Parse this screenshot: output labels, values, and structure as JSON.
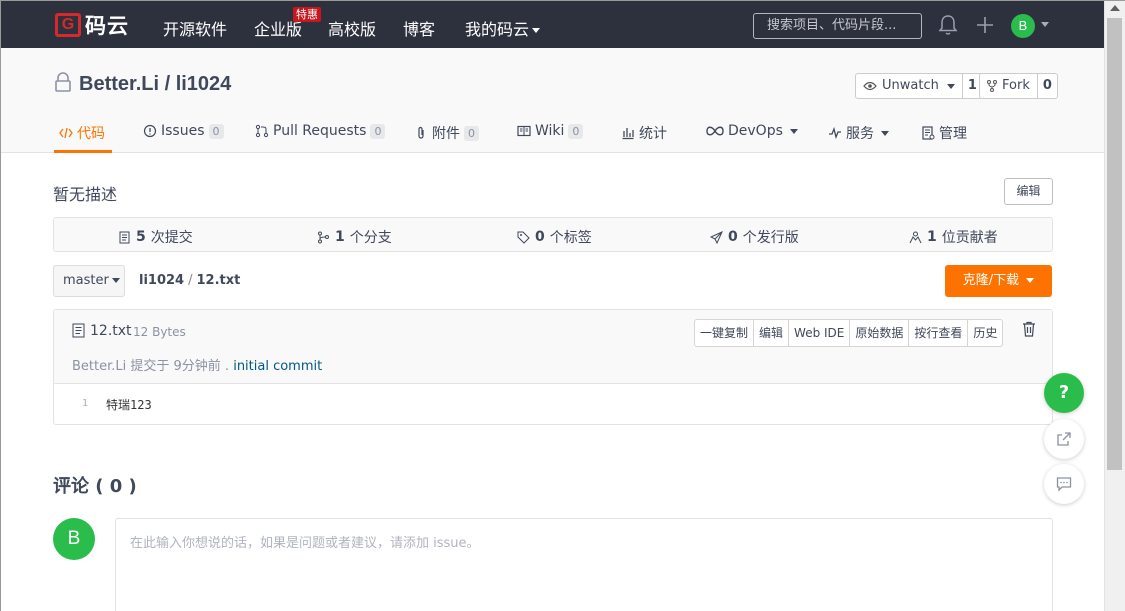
{
  "topnav": {
    "logo_mark": "G",
    "logo_text": "码云",
    "items": [
      "开源软件",
      "企业版",
      "高校版",
      "博客",
      "我的码云"
    ],
    "enterprise_badge": "特惠",
    "search_placeholder": "搜索项目、代码片段...",
    "avatar_letter": "B",
    "colors": {
      "bg": "#2d313e",
      "brand": "#d7292c",
      "avatar": "#2abd4c"
    }
  },
  "repo": {
    "title": "Better.Li / li1024",
    "watch_label": "Unwatch",
    "watch_count": "1",
    "fork_label": "Fork",
    "fork_count": "0"
  },
  "tabs": {
    "code": "代码",
    "issues": "Issues",
    "issues_count": "0",
    "pulls": "Pull Requests",
    "pulls_count": "0",
    "attachments": "附件",
    "attachments_count": "0",
    "wiki": "Wiki",
    "wiki_count": "0",
    "stats": "统计",
    "devops": "DevOps",
    "service": "服务",
    "manage": "管理"
  },
  "main": {
    "description": "暂无描述",
    "edit_label": "编辑",
    "stats": {
      "commits_num": "5",
      "commits_label": "次提交",
      "branches_num": "1",
      "branches_label": "个分支",
      "tags_num": "0",
      "tags_label": "个标签",
      "releases_num": "0",
      "releases_label": "个发行版",
      "contributors_num": "1",
      "contributors_label": "位贡献者"
    },
    "branch": "master",
    "breadcrumb_repo": "li1024",
    "breadcrumb_sep": "/",
    "breadcrumb_file": "12.txt",
    "clone_label": "克隆/下载"
  },
  "file": {
    "name": "12.txt",
    "size": "12 Bytes",
    "commit_author": "Better.Li",
    "commit_meta": "提交于 9分钟前 .",
    "commit_message": "initial commit",
    "actions": [
      "一键复制",
      "编辑",
      "Web IDE",
      "原始数据",
      "按行查看",
      "历史"
    ],
    "lines": [
      {
        "num": "1",
        "text": "特瑞123"
      }
    ]
  },
  "float": {
    "help": "?"
  },
  "comments": {
    "title": "评论 ( 0 )",
    "avatar_letter": "B",
    "placeholder": "在此输入你想说的话，如果是问题或者建议，请添加 issue。"
  },
  "accent": "#fe7300"
}
